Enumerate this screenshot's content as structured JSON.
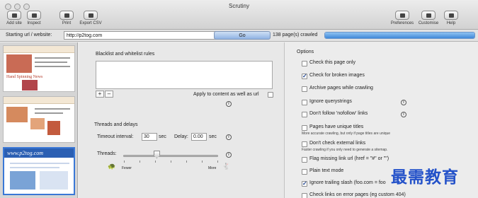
{
  "window": {
    "title": "Scrutiny"
  },
  "toolbar": {
    "add_site": "Add site",
    "inspect": "Inspect",
    "print": "Print",
    "export_csv": "Export CSV",
    "preferences": "Preferences",
    "customise": "Customise",
    "help": "Help"
  },
  "urlbar": {
    "label": "Starting url / website:",
    "url": "http://p2tog.com",
    "go": "Go",
    "status": "138 page(s) crawled",
    "progress": 1.0
  },
  "thumbnails": [
    {
      "title": "Hand Spinning News"
    },
    {
      "title": ""
    },
    {
      "title": "www.p2tog.com"
    }
  ],
  "blacklist": {
    "heading": "Blacklist and whitelist rules",
    "add": "+",
    "remove": "–",
    "apply_label": "Apply to content as well as url"
  },
  "threads": {
    "heading": "Threads and delays",
    "timeout_label": "Timeout interval:",
    "timeout_value": "30",
    "timeout_unit": "sec",
    "delay_label": "Delay:",
    "delay_value": "0.00",
    "delay_unit": "sec",
    "threads_label": "Threads:",
    "fewer": "Fewer",
    "more": "More",
    "slider_level": 0.35
  },
  "options": {
    "heading": "Options",
    "items": [
      {
        "label": "Check this page only",
        "checked": false,
        "sub": ""
      },
      {
        "label": "Check for broken images",
        "checked": true,
        "sub": ""
      },
      {
        "label": "Archive pages while crawling",
        "checked": false,
        "sub": ""
      },
      {
        "label": "Ignore querystrings",
        "checked": false,
        "sub": ""
      },
      {
        "label": "Don't follow 'nofollow' links",
        "checked": false,
        "sub": ""
      },
      {
        "label": "Pages have unique titles",
        "checked": false,
        "sub": "More accurate crawling, but only if page titles are unique"
      },
      {
        "label": "Don't check external links",
        "checked": false,
        "sub": "Faster crawling if you only need to generate a sitemap."
      },
      {
        "label": "Flag missing link url (href = \"#\"  or  \"\")",
        "checked": false,
        "sub": ""
      },
      {
        "label": "Plain text mode",
        "checked": false,
        "sub": ""
      },
      {
        "label": "Ignore trailing slash (foo.com = foo",
        "checked": true,
        "sub": ""
      },
      {
        "label": "Check links on error pages (eg custom 404)",
        "checked": false,
        "sub": ""
      }
    ]
  },
  "watermark": "最需教育",
  "icons": [
    "add-site-icon",
    "inspect-icon",
    "print-icon",
    "export-csv-icon",
    "preferences-icon",
    "customise-icon",
    "help-icon",
    "info-icon",
    "tortoise-icon",
    "hare-icon"
  ]
}
